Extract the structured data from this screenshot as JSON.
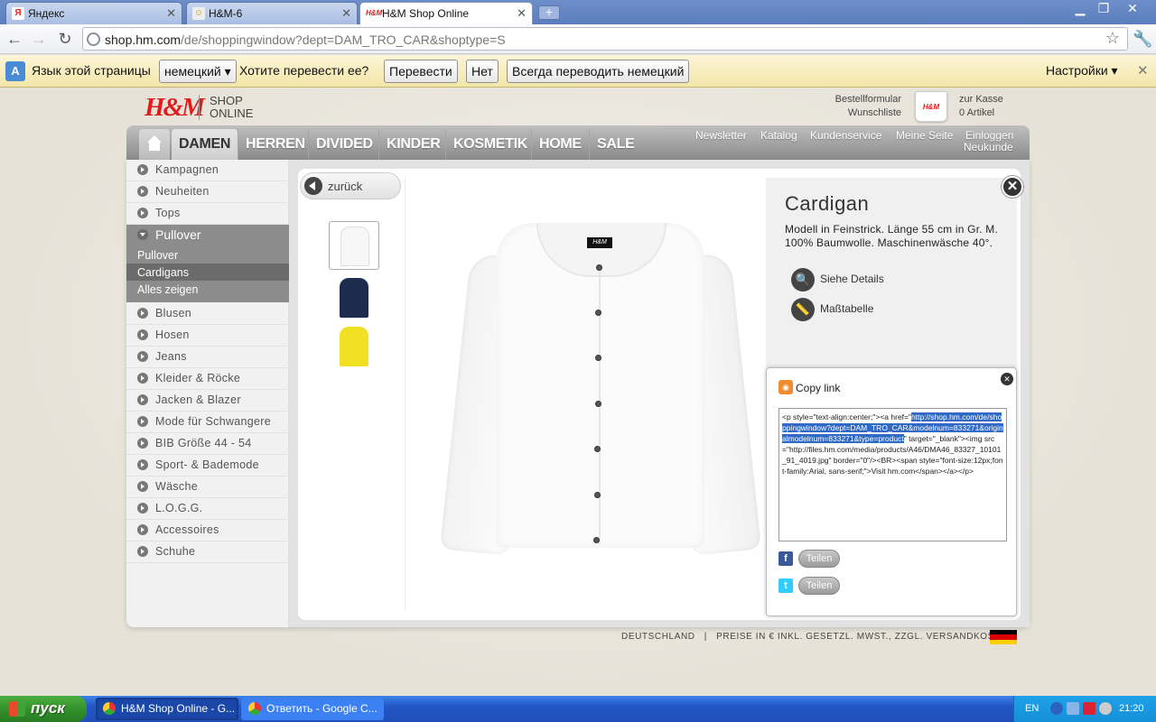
{
  "browser": {
    "tabs": [
      {
        "label": "Яндекс",
        "icon": "yandex-icon"
      },
      {
        "label": "H&M-6",
        "icon": "page-icon"
      },
      {
        "label": "H&M Shop Online",
        "icon": "hm-icon"
      }
    ],
    "url_host": "shop.hm.com",
    "url_path": "/de/shoppingwindow?dept=DAM_TRO_CAR&shoptype=S"
  },
  "infobar": {
    "prompt": "Язык этой страницы",
    "language_select": "немецкий",
    "question": "Хотите перевести ее?",
    "translate_button": "Перевести",
    "no_button": "Нет",
    "always_button": "Всегда переводить немецкий",
    "settings": "Настройки"
  },
  "site": {
    "logo": "H&M",
    "shop_line1": "SHOP",
    "shop_line2": "ONLINE",
    "order_form": "Bestellformular",
    "wishlist": "Wunschliste",
    "checkout": "zur Kasse",
    "cart_count": "0 Artikel",
    "nav_tabs": [
      "DAMEN",
      "HERREN",
      "DIVIDED",
      "KINDER",
      "KOSMETIK",
      "HOME",
      "SALE"
    ],
    "nav_right": [
      "Newsletter",
      "Katalog",
      "Kundenservice",
      "Meine Seite",
      "Einloggen"
    ],
    "new_customer": "Neukunde"
  },
  "sidebar": {
    "top_items": [
      "Kampagnen",
      "Neuheiten",
      "Tops"
    ],
    "open_category": "Pullover",
    "sub_items": [
      "Pullover",
      "Cardigans",
      "Alles zeigen"
    ],
    "bottom_items": [
      "Blusen",
      "Hosen",
      "Jeans",
      "Kleider & Röcke",
      "Jacken & Blazer",
      "Mode für Schwangere",
      "BIB Größe 44 - 54",
      "Sport- & Bademode",
      "Wäsche",
      "L.O.G.G.",
      "Accessoires",
      "Schuhe"
    ]
  },
  "product": {
    "back": "zurück",
    "name": "Cardigan",
    "description": "Modell in Feinstrick. Länge 55 cm in Gr. M. 100% Baumwolle. Maschinenwäsche 40°.",
    "details_link": "Siehe Details",
    "size_chart_link": "Maßtabelle",
    "thumbnail_colors": [
      "#ffffff",
      "#1d2b4c",
      "#f1e024"
    ],
    "garment_label": "H&M"
  },
  "copy_link": {
    "title": "Copy link",
    "code_before": "<p style=\"text-align:center;\"><a href=\"",
    "code_selected": "http://shop.hm.com/de/shoppingwindow?dept=DAM_TRO_CAR&modelnum=833271&originalmodelnum=833271&type=product",
    "code_after": "\" target=\"_blank\"><img src=\"http://files.hm.com/media/products/A46/DMA46_83327_10101_91_4019.jpg\" border=\"0\"/><BR><span style=\"font-size:12px;font-family:Arial, sans-serif;\">Visit hm.com</span></a></p>",
    "share_facebook": "Teilen",
    "share_twitter": "Teilen"
  },
  "footer": {
    "country": "DEUTSCHLAND",
    "separator": "|",
    "prices": "PREISE IN € INKL. GESETZL. MWST., ZZGL. VERSANDKOSTEN"
  },
  "taskbar": {
    "start": "пуск",
    "items": [
      "H&M Shop Online - G...",
      "Ответить - Google C..."
    ],
    "lang": "EN",
    "clock": "21:20"
  }
}
